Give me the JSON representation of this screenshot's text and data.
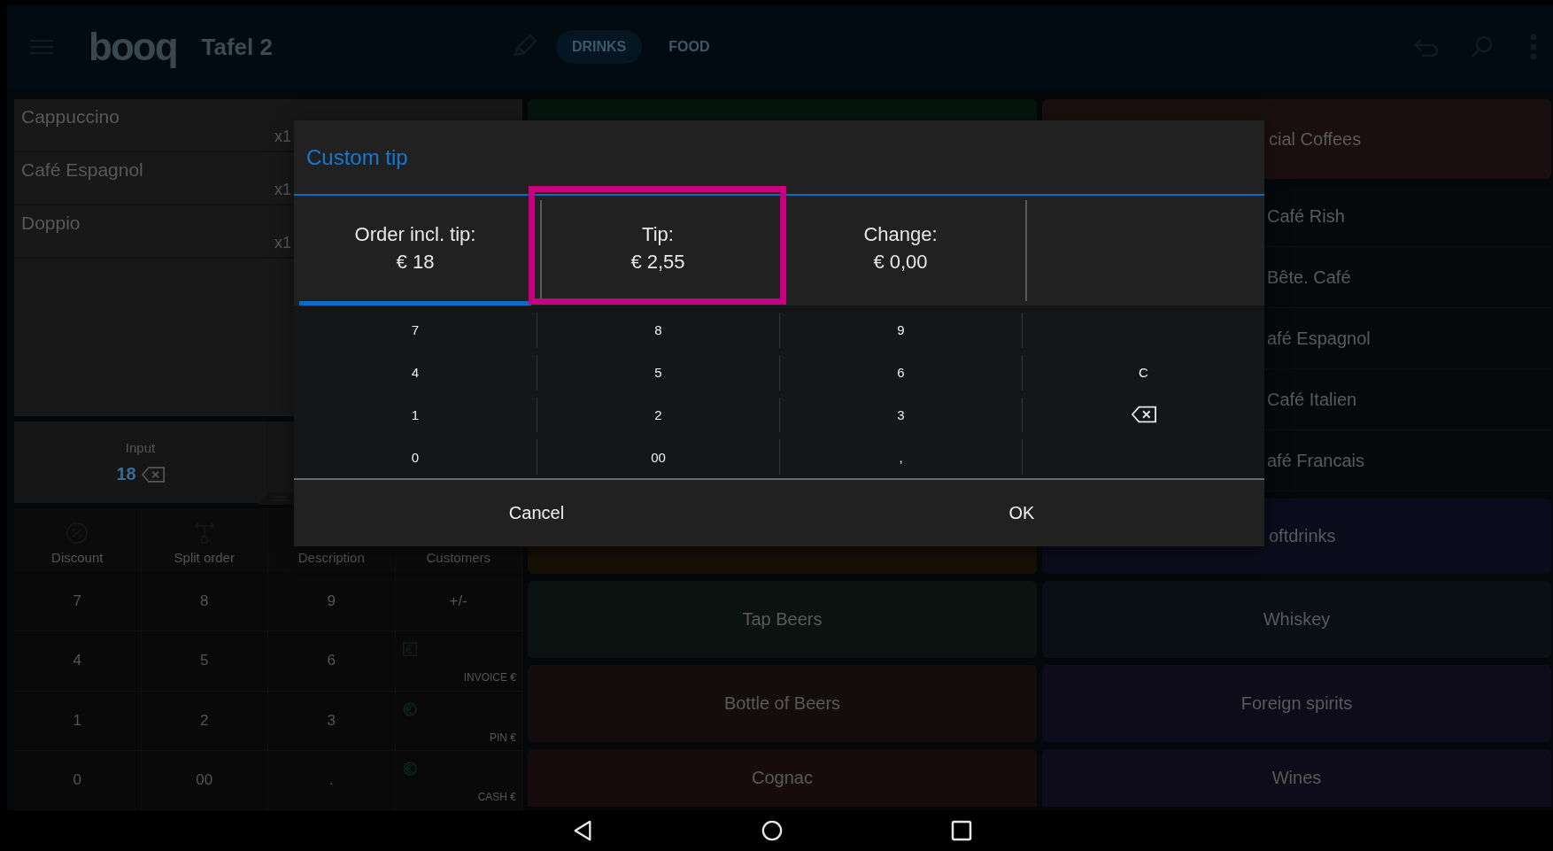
{
  "top_bar": {
    "logo": "booq",
    "title": "Tafel 2",
    "tabs": [
      {
        "label": "DRINKS",
        "selected": true
      },
      {
        "label": "FOOD",
        "selected": false
      }
    ]
  },
  "order_items": [
    {
      "name": "Cappuccino",
      "qty": "x1"
    },
    {
      "name": "Café Espagnol",
      "qty": "x1"
    },
    {
      "name": "Doppio",
      "qty": "x1"
    }
  ],
  "input": {
    "label": "Input",
    "value": "18"
  },
  "actions": [
    {
      "kind": "discount",
      "label": "Discount"
    },
    {
      "kind": "split",
      "label": "Split order"
    },
    {
      "kind": "plain",
      "label": "Description"
    },
    {
      "kind": "plain",
      "label": "Customers"
    }
  ],
  "numpad": [
    {
      "kind": "key",
      "label": "7"
    },
    {
      "kind": "key",
      "label": "8"
    },
    {
      "kind": "key",
      "label": "9"
    },
    {
      "kind": "key",
      "label": "+/-"
    },
    {
      "kind": "key",
      "label": "4"
    },
    {
      "kind": "key",
      "label": "5"
    },
    {
      "kind": "key",
      "label": "6"
    },
    {
      "kind": "invoice",
      "label": "INVOICE €"
    },
    {
      "kind": "key",
      "label": "1"
    },
    {
      "kind": "key",
      "label": "2"
    },
    {
      "kind": "key",
      "label": "3"
    },
    {
      "kind": "pin",
      "label": "PIN €"
    },
    {
      "kind": "key",
      "label": "0"
    },
    {
      "kind": "key",
      "label": "00"
    },
    {
      "kind": "key",
      "label": "."
    },
    {
      "kind": "cash",
      "label": "CASH €"
    }
  ],
  "categories_middle": [
    {
      "color": "#07150f"
    },
    {
      "color": "#161005"
    },
    {
      "label": "Tap Beers",
      "color": "#0a130f"
    },
    {
      "label": "Bottle of Beers",
      "color": "#130e0d"
    },
    {
      "label": "Cognac",
      "color": "#180b0d"
    }
  ],
  "categories_right": [
    {
      "kind": "tile",
      "label": "cial Coffees",
      "color": "#1a0f0f"
    },
    {
      "kind": "products",
      "items": [
        "Café Rish",
        "Bête. Café",
        "afé Espagnol",
        "Café Italien",
        "afé Francais"
      ]
    },
    {
      "kind": "tile",
      "label": "oftdrinks",
      "color": "#0c0b1c"
    },
    {
      "kind": "tile",
      "label": "Whiskey",
      "color": "#0a0f16"
    },
    {
      "kind": "tile",
      "label": "Foreign spirits",
      "color": "#0e0b1a"
    },
    {
      "kind": "tile",
      "label": "Wines",
      "color": "#0e0b1a"
    }
  ],
  "dialog": {
    "title": "Custom tip",
    "tabs": [
      {
        "label": "Order incl. tip:",
        "value": "€ 18",
        "selected": true,
        "highlighted": false
      },
      {
        "label": "Tip:",
        "value": "€ 2,55",
        "selected": false,
        "highlighted": true
      },
      {
        "label": "Change:",
        "value": "€ 0,00",
        "selected": false,
        "highlighted": false
      }
    ],
    "keys": [
      {
        "kind": "key",
        "label": "7"
      },
      {
        "kind": "key",
        "label": "8"
      },
      {
        "kind": "key",
        "label": "9"
      },
      {
        "kind": "blank"
      },
      {
        "kind": "key",
        "label": "4"
      },
      {
        "kind": "key",
        "label": "5"
      },
      {
        "kind": "key",
        "label": "6"
      },
      {
        "kind": "key",
        "label": "C"
      },
      {
        "kind": "key",
        "label": "1"
      },
      {
        "kind": "key",
        "label": "2"
      },
      {
        "kind": "key",
        "label": "3"
      },
      {
        "kind": "backspace"
      },
      {
        "kind": "key",
        "label": "0"
      },
      {
        "kind": "key",
        "label": "00"
      },
      {
        "kind": "key",
        "label": ","
      },
      {
        "kind": "blank"
      }
    ],
    "buttons": [
      "Cancel",
      "OK"
    ]
  }
}
